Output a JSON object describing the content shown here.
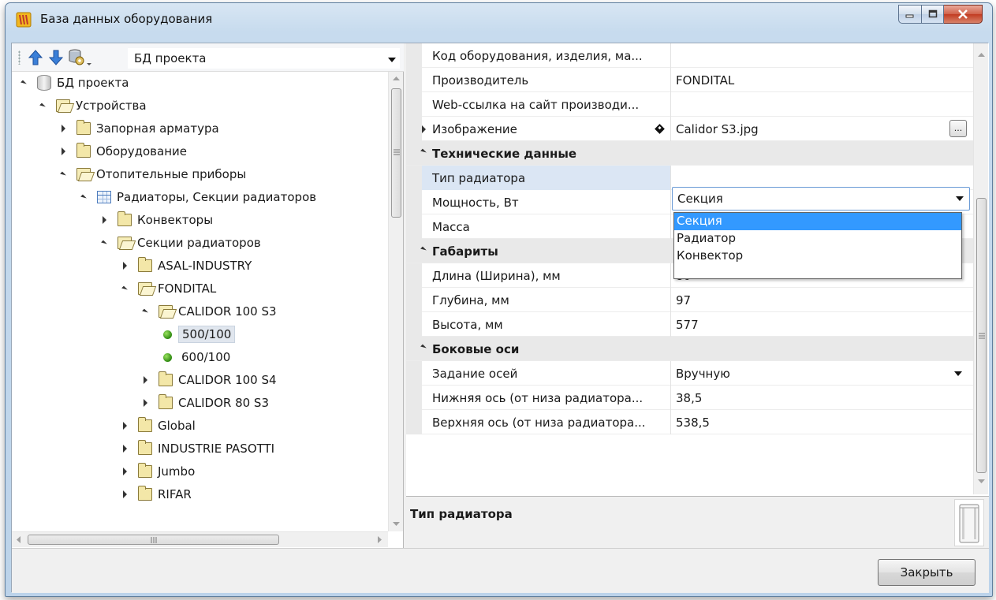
{
  "window": {
    "title": "База данных оборудования"
  },
  "toolbar": {
    "db_select_value": "БД проекта"
  },
  "tree": {
    "root": "БД проекта",
    "devices": "Устройства",
    "shutoff": "Запорная арматура",
    "equipment": "Оборудование",
    "heating": "Отопительные приборы",
    "radiators": "Радиаторы, Секции радиаторов",
    "convectors": "Конвекторы",
    "sections": "Секции радиаторов",
    "asal": "ASAL-INDUSTRY",
    "fondital": "FONDITAL",
    "calidor100s3": "CALIDOR 100 S3",
    "item500": "500/100",
    "item600": "600/100",
    "calidor100s4": "CALIDOR 100 S4",
    "calidor80s3": "CALIDOR 80 S3",
    "global": "Global",
    "pasotti": "INDUSTRIE PASOTTI",
    "jumbo": "Jumbo",
    "rifar": "RIFAR"
  },
  "grid": {
    "code_label": "Код оборудования, изделия, ма...",
    "code_value": "",
    "maker_label": "Производитель",
    "maker_value": "FONDITAL",
    "web_label": "Web-ссылка на сайт производи...",
    "web_value": "",
    "image_label": "Изображение",
    "image_value": "Calidor S3.jpg",
    "ellipsis": "...",
    "cat_tech": "Технические данные",
    "type_label": "Тип радиатора",
    "type_value": "Секция",
    "power_label": "Мощность, Вт",
    "mass_label": "Масса",
    "cat_dims": "Габариты",
    "length_label": "Длина (Ширина), мм",
    "length_value": "80",
    "depth_label": "Глубина, мм",
    "depth_value": "97",
    "height_label": "Высота, мм",
    "height_value": "577",
    "cat_axes": "Боковые оси",
    "axes_label": "Задание осей",
    "axes_value": "Вручную",
    "lower_label": "Нижняя ось (от низа радиатора...",
    "lower_value": "38,5",
    "upper_label": "Верхняя ось (от низа радиатора...",
    "upper_value": "538,5"
  },
  "dropdown": {
    "options": [
      "Секция",
      "Радиатор",
      "Конвектор"
    ],
    "selected_index": 0
  },
  "description": {
    "title": "Тип радиатора"
  },
  "buttons": {
    "close": "Закрыть"
  },
  "colors": {
    "selection": "#3399ff",
    "row_highlight": "#dbe6f4",
    "category_bg": "#e9e9e9"
  }
}
